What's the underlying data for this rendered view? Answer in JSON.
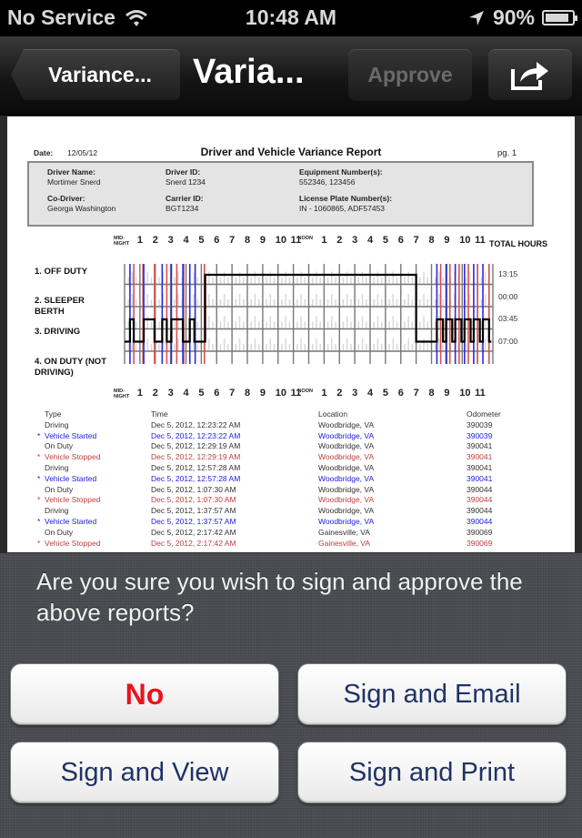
{
  "status_bar": {
    "carrier": "No Service",
    "time": "10:48 AM",
    "battery": "90%",
    "battery_level": 0.9,
    "icons": [
      "wifi-icon",
      "location-arrow-icon",
      "battery-icon"
    ]
  },
  "nav": {
    "back_label": "Variance...",
    "title": "Varia...",
    "approve_label": "Approve",
    "share_icon": "share-icon"
  },
  "report": {
    "date_label": "Date:",
    "date": "12/05/12",
    "title": "Driver and Vehicle Variance Report",
    "page": "pg. 1",
    "info": {
      "driver_name_label": "Driver Name:",
      "driver_name": "Mortimer Snerd",
      "driver_id_label": "Driver ID:",
      "driver_id": "Snerd 1234",
      "equipment_label": "Equipment Number(s):",
      "equipment": "552346, 123456",
      "co_driver_label": "Co-Driver:",
      "co_driver": "Georga Washington",
      "carrier_id_label": "Carrier ID:",
      "carrier_id": "BGT1234",
      "plate_label": "License Plate Number(s):",
      "plate": "IN - 1060865, ADF57453"
    },
    "chart": {
      "hour_labels": [
        "MID-NIGHT",
        "1",
        "2",
        "3",
        "4",
        "5",
        "6",
        "7",
        "8",
        "9",
        "10",
        "11",
        "NOON",
        "1",
        "2",
        "3",
        "4",
        "5",
        "6",
        "7",
        "8",
        "9",
        "10",
        "11"
      ],
      "total_hours_label": "TOTAL HOURS",
      "rows": [
        {
          "label": "1. OFF DUTY",
          "total": "13:15"
        },
        {
          "label": "2. SLEEPER BERTH",
          "total": "00:00"
        },
        {
          "label": "3. DRIVING",
          "total": "03:45"
        },
        {
          "label": "4. ON DUTY (NOT DRIVING)",
          "total": "07:00"
        }
      ],
      "duty_segments": [
        {
          "status": 4,
          "start": 0.0,
          "end": 0.35
        },
        {
          "status": 3,
          "start": 0.35,
          "end": 0.6
        },
        {
          "status": 4,
          "start": 0.6,
          "end": 1.25
        },
        {
          "status": 3,
          "start": 1.25,
          "end": 1.95
        },
        {
          "status": 4,
          "start": 1.95,
          "end": 2.45
        },
        {
          "status": 3,
          "start": 2.45,
          "end": 2.75
        },
        {
          "status": 4,
          "start": 2.75,
          "end": 3.05
        },
        {
          "status": 3,
          "start": 3.05,
          "end": 3.8
        },
        {
          "status": 4,
          "start": 3.8,
          "end": 4.25
        },
        {
          "status": 3,
          "start": 4.25,
          "end": 4.55
        },
        {
          "status": 4,
          "start": 4.55,
          "end": 5.25
        },
        {
          "status": 1,
          "start": 5.25,
          "end": 19.0
        },
        {
          "status": 4,
          "start": 19.0,
          "end": 20.35
        },
        {
          "status": 3,
          "start": 20.35,
          "end": 20.75
        },
        {
          "status": 4,
          "start": 20.75,
          "end": 20.95
        },
        {
          "status": 3,
          "start": 20.95,
          "end": 21.35
        },
        {
          "status": 4,
          "start": 21.35,
          "end": 21.55
        },
        {
          "status": 3,
          "start": 21.55,
          "end": 21.95
        },
        {
          "status": 4,
          "start": 21.95,
          "end": 22.15
        },
        {
          "status": 3,
          "start": 22.15,
          "end": 22.55
        },
        {
          "status": 4,
          "start": 22.55,
          "end": 22.75
        },
        {
          "status": 3,
          "start": 22.75,
          "end": 23.15
        },
        {
          "status": 4,
          "start": 23.15,
          "end": 23.35
        },
        {
          "status": 3,
          "start": 23.35,
          "end": 23.75
        },
        {
          "status": 4,
          "start": 23.75,
          "end": 23.9
        }
      ],
      "vehicle_started_hours": [
        0.35,
        1.25,
        2.45,
        3.05,
        3.8,
        4.25,
        4.6,
        20.35,
        20.95,
        21.55,
        22.15,
        22.75,
        23.35
      ],
      "vehicle_stopped_hours": [
        0.6,
        1.2,
        1.95,
        2.75,
        3.4,
        3.85,
        5.2,
        20.6,
        21.2,
        21.8,
        22.4,
        23.0,
        23.75
      ],
      "colors": {
        "started": "#2a2ae0",
        "stopped": "#d85050",
        "duty_line": "#000000"
      }
    },
    "log": {
      "headers": [
        "Type",
        "Time",
        "Location",
        "Odometer"
      ],
      "rows": [
        {
          "marker": "",
          "type": "Driving",
          "time": "Dec 5, 2012, 12:23:22 AM",
          "location": "Woodbridge, VA",
          "odometer": "390039",
          "color": "black"
        },
        {
          "marker": "*",
          "type": "Vehicle Started",
          "time": "Dec 5, 2012, 12:23:22 AM",
          "location": "Woodbridge, VA",
          "odometer": "390039",
          "color": "blue"
        },
        {
          "marker": "",
          "type": "On Duty",
          "time": "Dec 5, 2012, 12:29:19 AM",
          "location": "Woodbridge, VA",
          "odometer": "390041",
          "color": "black"
        },
        {
          "marker": "*",
          "type": "Vehicle Stopped",
          "time": "Dec 5, 2012, 12:29:19 AM",
          "location": "Woodbridge, VA",
          "odometer": "390041",
          "color": "red"
        },
        {
          "marker": "",
          "type": "Driving",
          "time": "Dec 5, 2012, 12:57:28 AM",
          "location": "Woodbridge, VA",
          "odometer": "390041",
          "color": "black"
        },
        {
          "marker": "*",
          "type": "Vehicle Started",
          "time": "Dec 5, 2012, 12:57:28 AM",
          "location": "Woodbridge, VA",
          "odometer": "390041",
          "color": "blue"
        },
        {
          "marker": "",
          "type": "On Duty",
          "time": "Dec 5, 2012, 1:07:30 AM",
          "location": "Woodbridge, VA",
          "odometer": "390044",
          "color": "black"
        },
        {
          "marker": "*",
          "type": "Vehicle Stopped",
          "time": "Dec 5, 2012, 1:07:30 AM",
          "location": "Woodbridge, VA",
          "odometer": "390044",
          "color": "red"
        },
        {
          "marker": "",
          "type": "Driving",
          "time": "Dec 5, 2012, 1:37:57 AM",
          "location": "Woodbridge, VA",
          "odometer": "390044",
          "color": "black"
        },
        {
          "marker": "*",
          "type": "Vehicle Started",
          "time": "Dec 5, 2012, 1:37:57 AM",
          "location": "Woodbridge, VA",
          "odometer": "390044",
          "color": "blue"
        },
        {
          "marker": "",
          "type": "On Duty",
          "time": "Dec 5, 2012, 2:17:42 AM",
          "location": "Gainesville, VA",
          "odometer": "390069",
          "color": "black"
        },
        {
          "marker": "*",
          "type": "Vehicle Stopped",
          "time": "Dec 5, 2012, 2:17:42 AM",
          "location": "Gainesville, VA",
          "odometer": "390069",
          "color": "red"
        }
      ]
    }
  },
  "action_sheet": {
    "message": "Are you sure you wish to sign and approve the above reports?",
    "buttons": {
      "no": "No",
      "sign_email": "Sign and Email",
      "sign_view": "Sign and View",
      "sign_print": "Sign and Print"
    },
    "colors": {
      "destructive": "#e8141e",
      "default": "#1f3264"
    }
  }
}
